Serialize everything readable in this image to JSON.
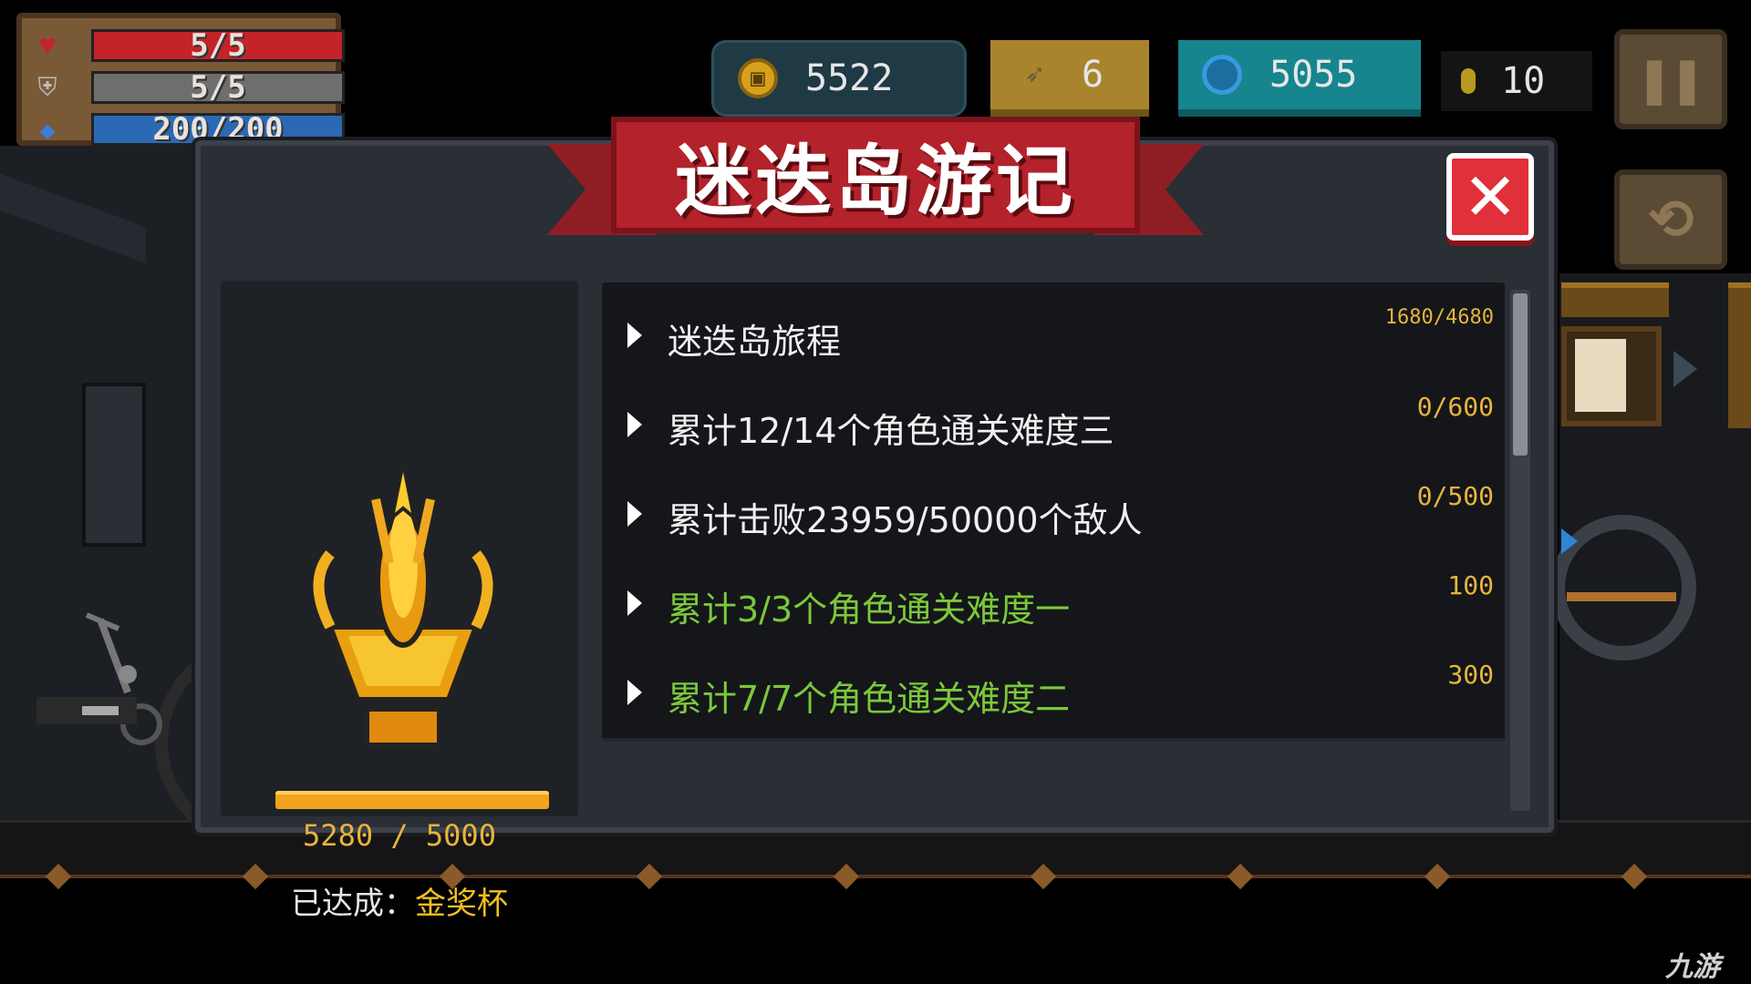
{
  "hud": {
    "hp": "5/5",
    "armor": "5/5",
    "energy": "200/200",
    "gold": "5522",
    "fish": "6",
    "gems": "5055",
    "seeds": "10"
  },
  "dialog": {
    "title": "迷迭岛游记",
    "close_symbol": "✕",
    "progress": {
      "current": 5280,
      "max": 5000,
      "text": "5280 / 5000"
    },
    "achieved_label": "已达成：",
    "achieved_value": "金奖杯",
    "tasks": [
      {
        "label": "迷迭岛旅程",
        "reward": "1680/4680",
        "completed": false
      },
      {
        "label": "累计12/14个角色通关难度三",
        "reward": "0/600",
        "completed": false
      },
      {
        "label": "累计击败23959/50000个敌人",
        "reward": "0/500",
        "completed": false
      },
      {
        "label": "累计3/3个角色通关难度一",
        "reward": "100",
        "completed": true
      },
      {
        "label": "累计7/7个角色通关难度二",
        "reward": "300",
        "completed": true
      }
    ]
  },
  "watermark": "九游",
  "colors": {
    "ribbon": "#b4222c",
    "completed_text": "#7cc83a",
    "reward_text": "#e8b43c",
    "close_button": "#e0303a"
  },
  "icons": [
    "heart-icon",
    "shield-icon",
    "energy-diamond-icon",
    "gold-coin-icon",
    "fish-icon",
    "gem-icon",
    "seed-icon",
    "pause-icon",
    "swap-icon",
    "close-icon",
    "trophy-icon",
    "expand-triangle-icon"
  ]
}
